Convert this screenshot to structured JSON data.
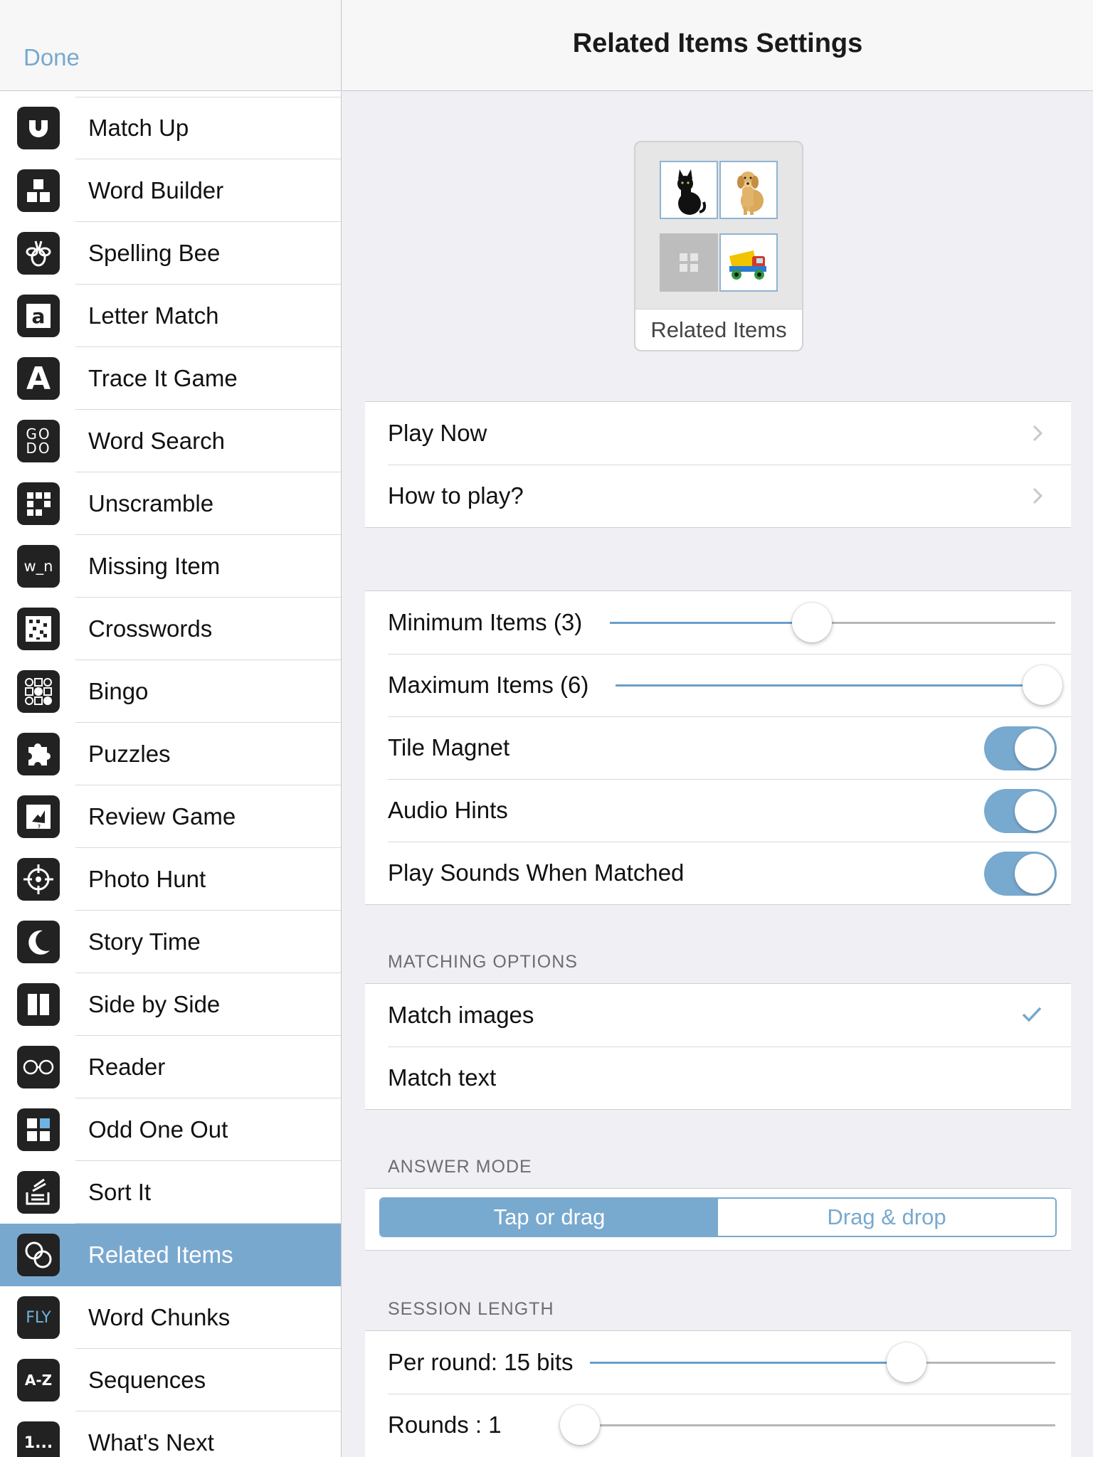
{
  "sidebar": {
    "done_label": "Done",
    "items": [
      {
        "label": "Match Up",
        "icon": "magnet-icon"
      },
      {
        "label": "Word Builder",
        "icon": "blocks-icon"
      },
      {
        "label": "Spelling Bee",
        "icon": "bee-icon"
      },
      {
        "label": "Letter Match",
        "icon": "letter-a-stamp-icon",
        "glyph": "a"
      },
      {
        "label": "Trace It Game",
        "icon": "trace-letter-icon",
        "glyph": "A"
      },
      {
        "label": "Word Search",
        "icon": "word-search-icon",
        "glyph": "GO DO"
      },
      {
        "label": "Unscramble",
        "icon": "scrambled-grid-icon"
      },
      {
        "label": "Missing Item",
        "icon": "missing-letter-icon",
        "glyph": "w_n"
      },
      {
        "label": "Crosswords",
        "icon": "crossword-grid-icon"
      },
      {
        "label": "Bingo",
        "icon": "bingo-dots-icon"
      },
      {
        "label": "Puzzles",
        "icon": "puzzle-piece-icon"
      },
      {
        "label": "Review Game",
        "icon": "review-card-icon"
      },
      {
        "label": "Photo Hunt",
        "icon": "crosshair-icon"
      },
      {
        "label": "Story Time",
        "icon": "moon-icon"
      },
      {
        "label": "Side by Side",
        "icon": "two-columns-icon"
      },
      {
        "label": "Reader",
        "icon": "glasses-icon"
      },
      {
        "label": "Odd One Out",
        "icon": "odd-tile-icon"
      },
      {
        "label": "Sort It",
        "icon": "sort-tray-icon"
      },
      {
        "label": "Related Items",
        "icon": "linked-circles-icon",
        "selected": true
      },
      {
        "label": "Word Chunks",
        "icon": "word-chunk-icon",
        "glyph": "FLY"
      },
      {
        "label": "Sequences",
        "icon": "a-z-icon",
        "glyph": "A-Z"
      },
      {
        "label": "What's Next",
        "icon": "number-sequence-icon",
        "glyph": "1..."
      }
    ]
  },
  "header": {
    "title": "Related Items Settings"
  },
  "preview": {
    "label": "Related Items",
    "tiles": [
      "cat-photo",
      "dog-photo",
      "empty-placeholder-icon",
      "toy-truck-photo"
    ]
  },
  "nav_rows": [
    {
      "label": "Play Now"
    },
    {
      "label": "How to play?"
    }
  ],
  "settings": {
    "min_items": {
      "label": "Minimum Items (3)",
      "value": 3,
      "min": 1,
      "max": 6
    },
    "max_items": {
      "label": "Maximum Items (6)",
      "value": 6,
      "min": 1,
      "max": 6
    },
    "tile_magnet": {
      "label": "Tile Magnet",
      "on": true
    },
    "audio_hints": {
      "label": "Audio Hints",
      "on": true
    },
    "play_sounds": {
      "label": "Play Sounds When Matched",
      "on": true
    }
  },
  "matching": {
    "header": "MATCHING OPTIONS",
    "options": [
      {
        "label": "Match images",
        "checked": true
      },
      {
        "label": "Match text",
        "checked": false
      }
    ]
  },
  "answer_mode": {
    "header": "ANSWER MODE",
    "options": [
      "Tap or drag",
      "Drag & drop"
    ],
    "selected": 0
  },
  "session": {
    "header": "SESSION LENGTH",
    "per_round": {
      "label": "Per round: 15 bits",
      "value_fraction": 0.68
    },
    "rounds": {
      "label": "Rounds : 1",
      "value_fraction": 0.0
    }
  },
  "colors": {
    "accent": "#78a9cf",
    "selected_row": "#79a8cf",
    "background": "#efeff4"
  }
}
